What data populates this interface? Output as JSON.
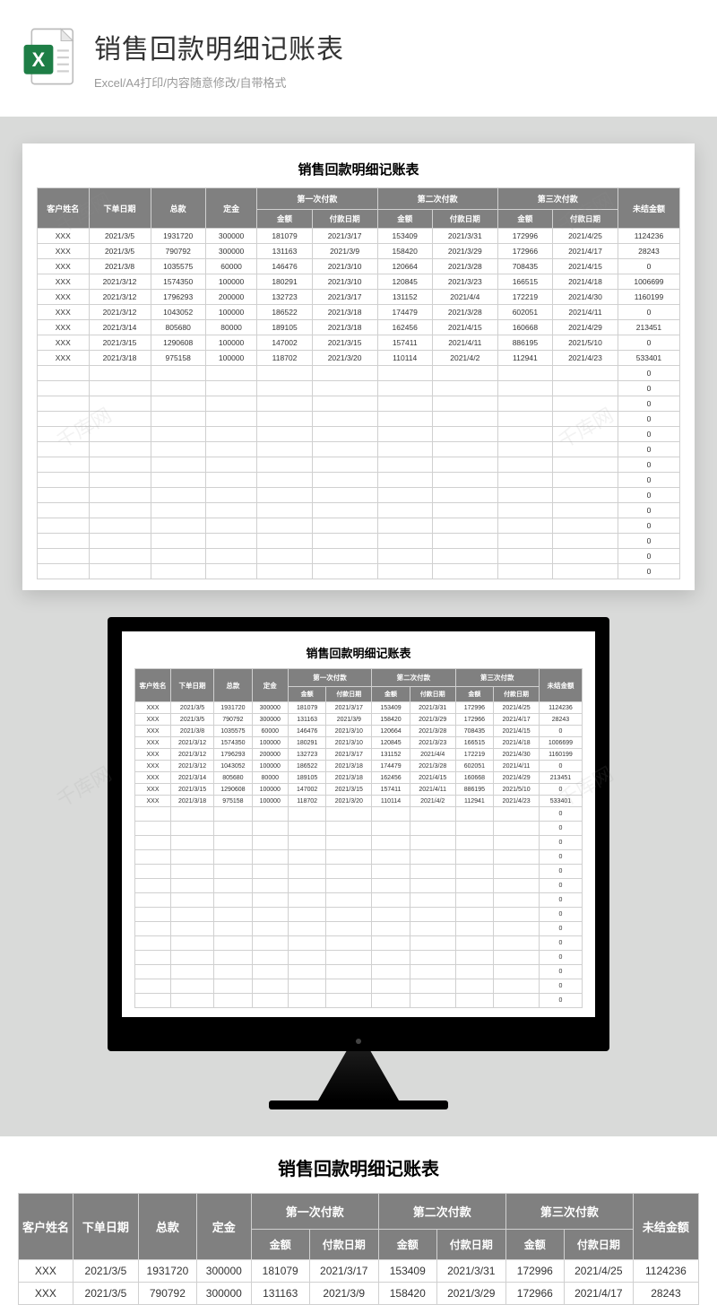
{
  "header": {
    "title": "销售回款明细记账表",
    "subtitle": "Excel/A4打印/内容随意修改/自带格式",
    "icon_name": "excel-file-icon"
  },
  "sheet": {
    "title": "销售回款明细记账表",
    "columns": {
      "customer": "客户姓名",
      "order_date": "下单日期",
      "total": "总款",
      "deposit": "定金",
      "pay1": "第一次付款",
      "pay2": "第二次付款",
      "pay3": "第三次付款",
      "amount": "金额",
      "pay_date": "付款日期",
      "balance": "未结金额"
    },
    "rows": [
      {
        "customer": "XXX",
        "order_date": "2021/3/5",
        "total": "1931720",
        "deposit": "300000",
        "p1a": "181079",
        "p1d": "2021/3/17",
        "p2a": "153409",
        "p2d": "2021/3/31",
        "p3a": "172996",
        "p3d": "2021/4/25",
        "balance": "1124236"
      },
      {
        "customer": "XXX",
        "order_date": "2021/3/5",
        "total": "790792",
        "deposit": "300000",
        "p1a": "131163",
        "p1d": "2021/3/9",
        "p2a": "158420",
        "p2d": "2021/3/29",
        "p3a": "172966",
        "p3d": "2021/4/17",
        "balance": "28243"
      },
      {
        "customer": "XXX",
        "order_date": "2021/3/8",
        "total": "1035575",
        "deposit": "60000",
        "p1a": "146476",
        "p1d": "2021/3/10",
        "p2a": "120664",
        "p2d": "2021/3/28",
        "p3a": "708435",
        "p3d": "2021/4/15",
        "balance": "0"
      },
      {
        "customer": "XXX",
        "order_date": "2021/3/12",
        "total": "1574350",
        "deposit": "100000",
        "p1a": "180291",
        "p1d": "2021/3/10",
        "p2a": "120845",
        "p2d": "2021/3/23",
        "p3a": "166515",
        "p3d": "2021/4/18",
        "balance": "1006699"
      },
      {
        "customer": "XXX",
        "order_date": "2021/3/12",
        "total": "1796293",
        "deposit": "200000",
        "p1a": "132723",
        "p1d": "2021/3/17",
        "p2a": "131152",
        "p2d": "2021/4/4",
        "p3a": "172219",
        "p3d": "2021/4/30",
        "balance": "1160199"
      },
      {
        "customer": "XXX",
        "order_date": "2021/3/12",
        "total": "1043052",
        "deposit": "100000",
        "p1a": "186522",
        "p1d": "2021/3/18",
        "p2a": "174479",
        "p2d": "2021/3/28",
        "p3a": "602051",
        "p3d": "2021/4/11",
        "balance": "0"
      },
      {
        "customer": "XXX",
        "order_date": "2021/3/14",
        "total": "805680",
        "deposit": "80000",
        "p1a": "189105",
        "p1d": "2021/3/18",
        "p2a": "162456",
        "p2d": "2021/4/15",
        "p3a": "160668",
        "p3d": "2021/4/29",
        "balance": "213451"
      },
      {
        "customer": "XXX",
        "order_date": "2021/3/15",
        "total": "1290608",
        "deposit": "100000",
        "p1a": "147002",
        "p1d": "2021/3/15",
        "p2a": "157411",
        "p2d": "2021/4/11",
        "p3a": "886195",
        "p3d": "2021/5/10",
        "balance": "0"
      },
      {
        "customer": "XXX",
        "order_date": "2021/3/18",
        "total": "975158",
        "deposit": "100000",
        "p1a": "118702",
        "p1d": "2021/3/20",
        "p2a": "110114",
        "p2d": "2021/4/2",
        "p3a": "112941",
        "p3d": "2021/4/23",
        "balance": "533401"
      }
    ],
    "empty_balance": "0",
    "empty_row_count": 14
  },
  "watermark": "千库网",
  "bottom_preview_rows": 2
}
